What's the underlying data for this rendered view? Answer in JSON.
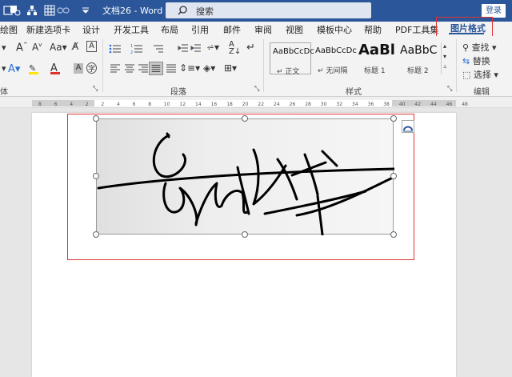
{
  "titlebar": {
    "document_title": "文档26  -  Word",
    "search_placeholder": "搜索",
    "login": "登录"
  },
  "tabs": [
    "绘图",
    "新建选项卡",
    "设计",
    "开发工具",
    "布局",
    "引用",
    "邮件",
    "审阅",
    "视图",
    "模板中心",
    "帮助",
    "PDF工具集",
    "图片格式"
  ],
  "ribbon": {
    "font_group": "体",
    "paragraph_group": "段落",
    "styles_group": "样式",
    "edit_group": "编辑",
    "styles": [
      {
        "preview": "AaBbCcDc",
        "name": "↵ 正文"
      },
      {
        "preview": "AaBbCcDc",
        "name": "↵ 无间隔"
      },
      {
        "preview": "AaBl",
        "name": "标题 1"
      },
      {
        "preview": "AaBbC",
        "name": "标题 2"
      }
    ],
    "edit_items": {
      "find": "查找",
      "replace": "替换",
      "select": "选择"
    }
  },
  "ruler_labels": [
    "8",
    "6",
    "4",
    "2",
    "2",
    "4",
    "6",
    "8",
    "10",
    "12",
    "14",
    "16",
    "18",
    "20",
    "22",
    "24",
    "26",
    "28",
    "30",
    "32",
    "34",
    "36",
    "38",
    "40",
    "42",
    "44",
    "46",
    "48"
  ],
  "document": {
    "image_description": "手写签名图片"
  }
}
